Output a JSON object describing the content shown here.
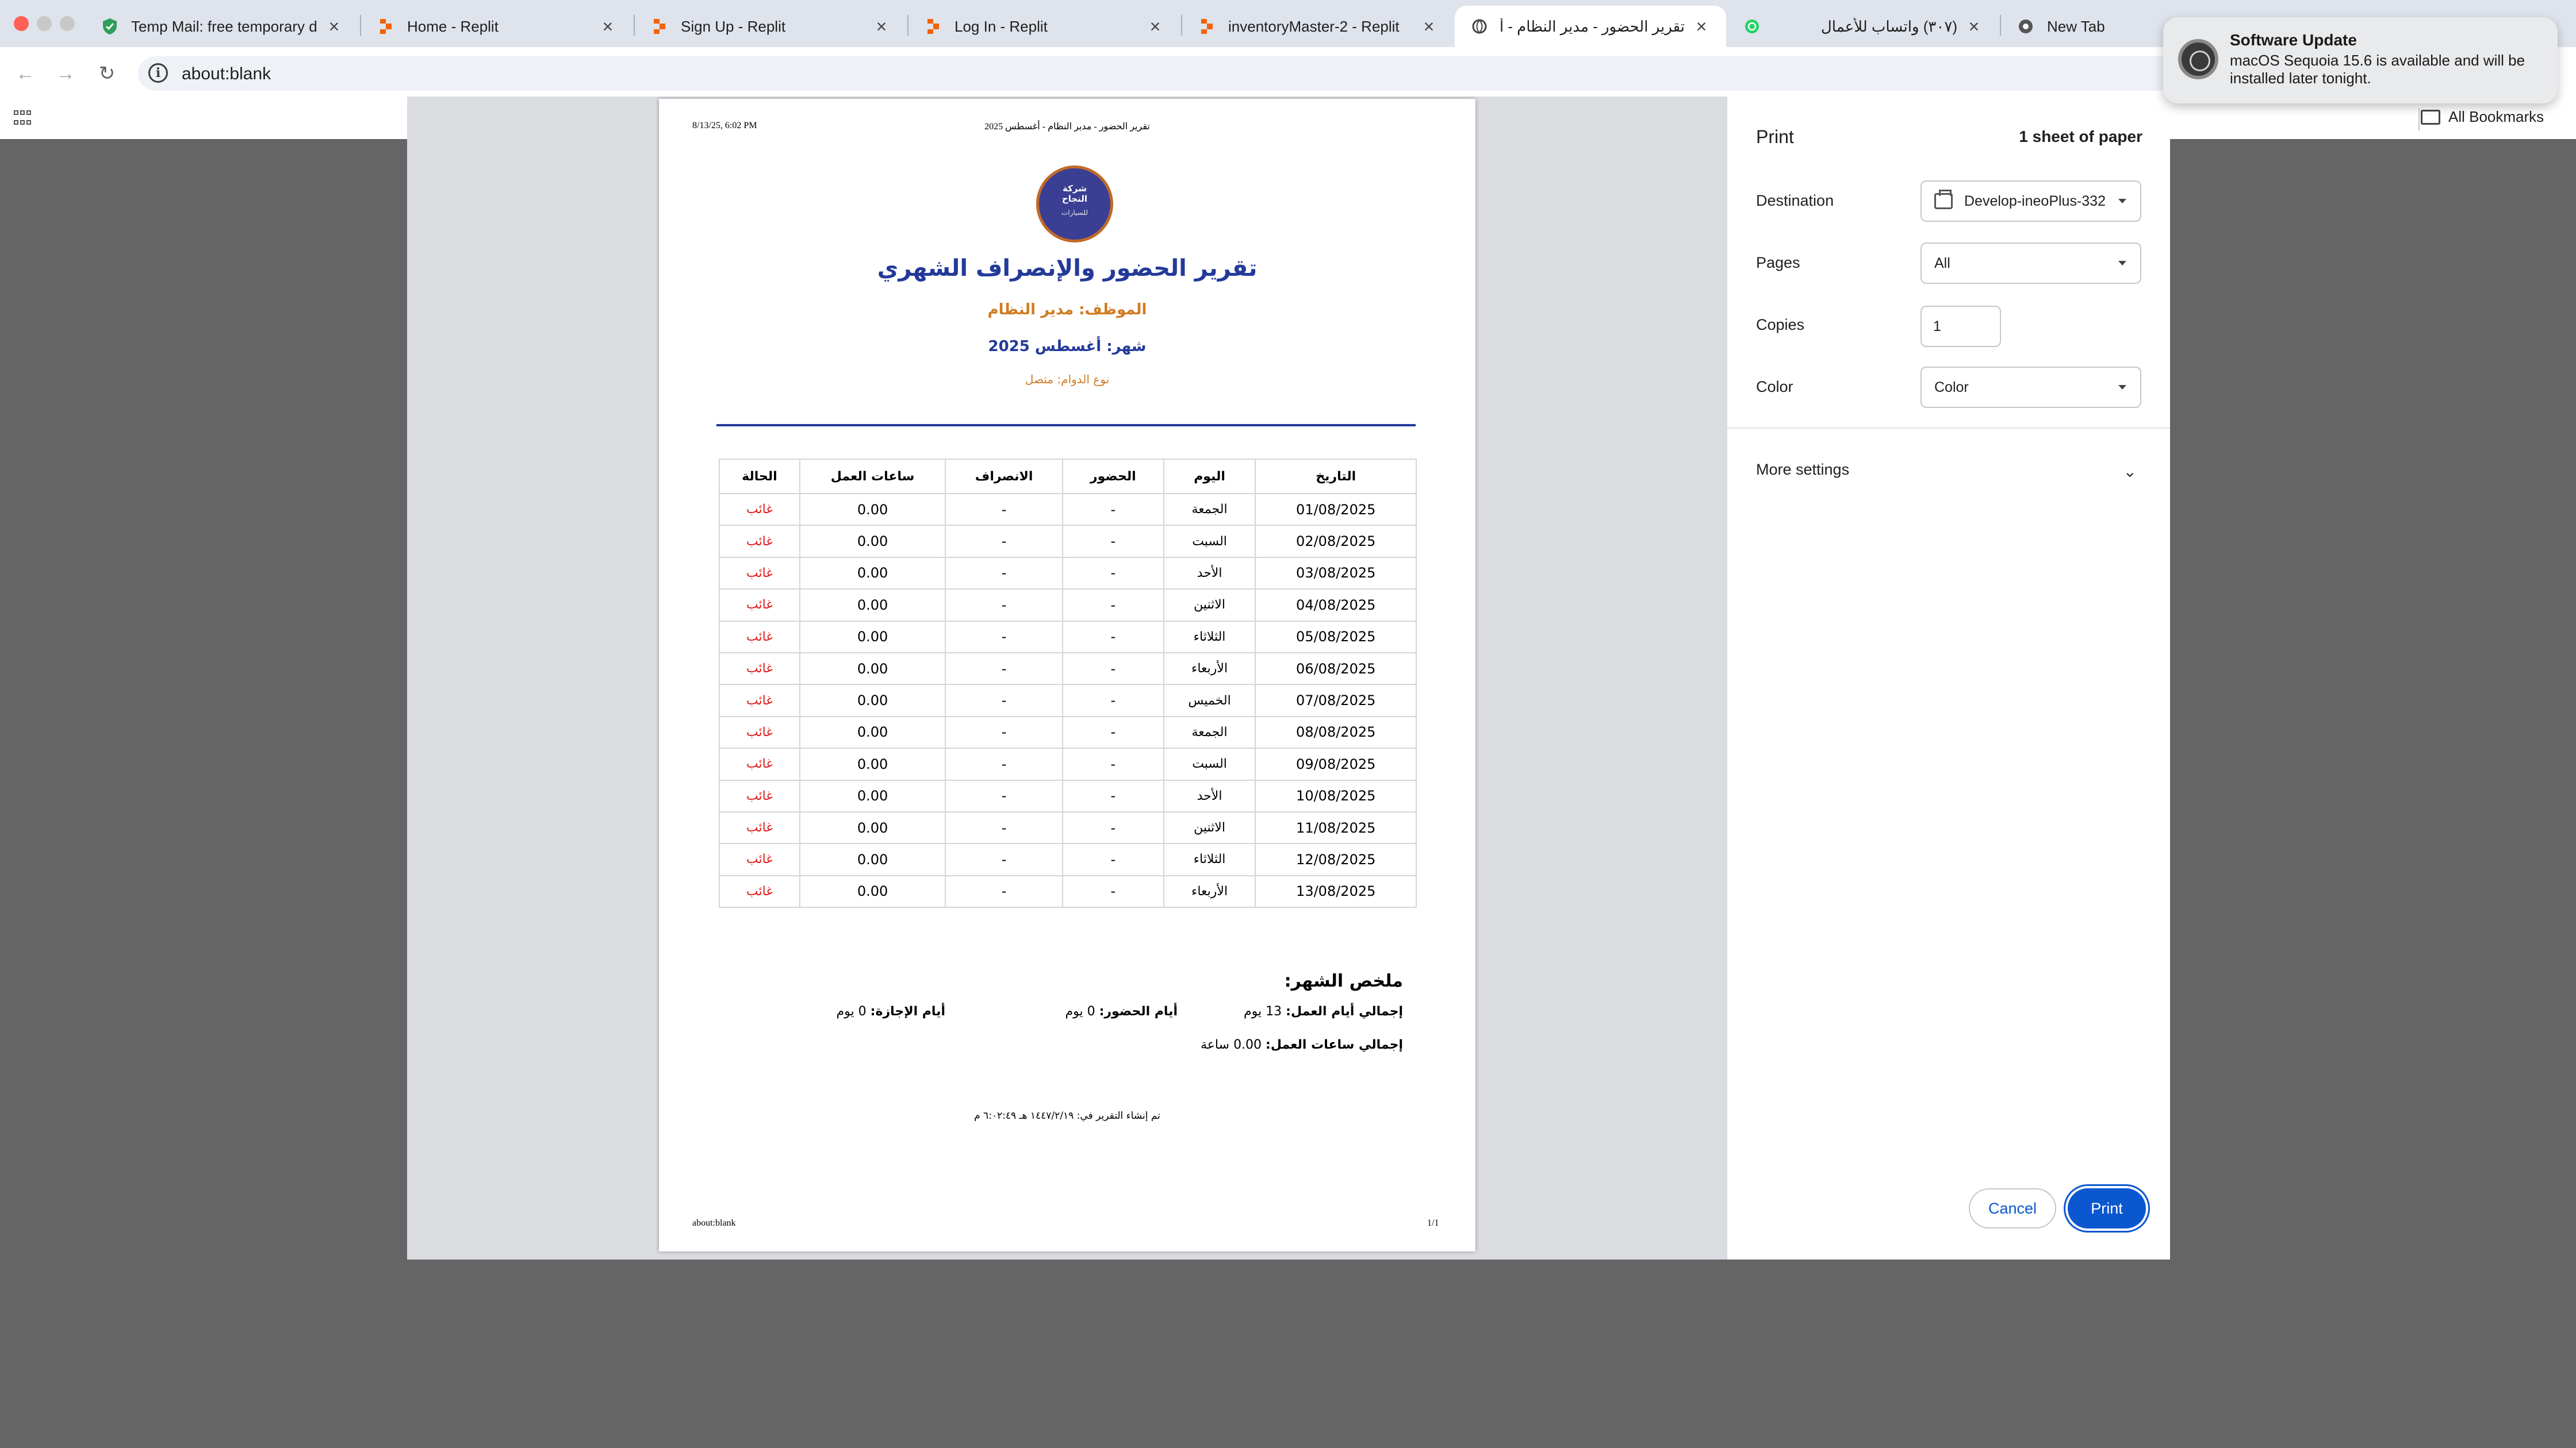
{
  "browser": {
    "tabs": [
      {
        "label": "Temp Mail: free temporary dis",
        "icon": "shield-check-icon",
        "color": "#2e9e5b"
      },
      {
        "label": "Home - Replit",
        "icon": "replit-icon",
        "color": "#f26207"
      },
      {
        "label": "Sign Up - Replit",
        "icon": "replit-icon",
        "color": "#f26207"
      },
      {
        "label": "Log In - Replit",
        "icon": "replit-icon",
        "color": "#f26207"
      },
      {
        "label": "inventoryMaster-2 - Replit",
        "icon": "replit-icon",
        "color": "#f26207"
      },
      {
        "label": "تقرير الحضور - مدير النظام - أغسطس",
        "icon": "globe-icon",
        "color": "#444444",
        "active": true
      },
      {
        "label": "(٣٠٧) واتساب للأعمال",
        "icon": "whatsapp-icon",
        "color": "#25d366"
      },
      {
        "label": "New Tab",
        "icon": "chrome-icon",
        "color": "#444444"
      }
    ],
    "url": "about:blank",
    "bookmarks_label": "All Bookmarks"
  },
  "report": {
    "header_left": "8/13/25, 6:02 PM",
    "header_center": "تقرير الحضور - مدير النظام - أغسطس 2025",
    "logo_line1": "شركة",
    "logo_line2": "النجاح",
    "logo_line3": "للسيارات",
    "title": "تقرير الحضور والإنصراف الشهري",
    "employee": "الموظف: مدير النظام",
    "month": "شهر: أغسطس 2025",
    "shift": "نوع الدوام: متصل",
    "columns": [
      "التاريخ",
      "اليوم",
      "الحضور",
      "الانصراف",
      "ساعات العمل",
      "الحالة"
    ],
    "rows": [
      {
        "date": "01/08/2025",
        "day": "الجمعة",
        "in": "-",
        "out": "-",
        "hours": "0.00",
        "status": "غائب"
      },
      {
        "date": "02/08/2025",
        "day": "السبت",
        "in": "-",
        "out": "-",
        "hours": "0.00",
        "status": "غائب"
      },
      {
        "date": "03/08/2025",
        "day": "الأحد",
        "in": "-",
        "out": "-",
        "hours": "0.00",
        "status": "غائب"
      },
      {
        "date": "04/08/2025",
        "day": "الاثنين",
        "in": "-",
        "out": "-",
        "hours": "0.00",
        "status": "غائب"
      },
      {
        "date": "05/08/2025",
        "day": "الثلاثاء",
        "in": "-",
        "out": "-",
        "hours": "0.00",
        "status": "غائب"
      },
      {
        "date": "06/08/2025",
        "day": "الأربعاء",
        "in": "-",
        "out": "-",
        "hours": "0.00",
        "status": "غائب"
      },
      {
        "date": "07/08/2025",
        "day": "الخميس",
        "in": "-",
        "out": "-",
        "hours": "0.00",
        "status": "غائب"
      },
      {
        "date": "08/08/2025",
        "day": "الجمعة",
        "in": "-",
        "out": "-",
        "hours": "0.00",
        "status": "غائب"
      },
      {
        "date": "09/08/2025",
        "day": "السبت",
        "in": "-",
        "out": "-",
        "hours": "0.00",
        "status": "غائب"
      },
      {
        "date": "10/08/2025",
        "day": "الأحد",
        "in": "-",
        "out": "-",
        "hours": "0.00",
        "status": "غائب"
      },
      {
        "date": "11/08/2025",
        "day": "الاثنين",
        "in": "-",
        "out": "-",
        "hours": "0.00",
        "status": "غائب"
      },
      {
        "date": "12/08/2025",
        "day": "الثلاثاء",
        "in": "-",
        "out": "-",
        "hours": "0.00",
        "status": "غائب"
      },
      {
        "date": "13/08/2025",
        "day": "الأربعاء",
        "in": "-",
        "out": "-",
        "hours": "0.00",
        "status": "غائب"
      }
    ],
    "summary_title": "ملخص الشهر:",
    "total_days_label": "إجمالي أيام العمل:",
    "total_days_value": "13 يوم",
    "present_days_label": "أيام الحضور:",
    "present_days_value": "0 يوم",
    "leave_days_label": "أيام الإجازة:",
    "leave_days_value": "0 يوم",
    "total_hours_label": "إجمالي ساعات العمل:",
    "total_hours_value": "0.00 ساعة",
    "generated_note": "تم إنشاء التقرير في: ١٤٤٧/٢/١٩ هـ ٦:٠٢:٤٩ م",
    "footer_left": "about:blank",
    "footer_right": "1/1"
  },
  "print_panel": {
    "title": "Print",
    "sheets": "1 sheet of paper",
    "destination_label": "Destination",
    "destination_value": "Develop-ineoPlus-332",
    "pages_label": "Pages",
    "pages_value": "All",
    "copies_label": "Copies",
    "copies_value": "1",
    "color_label": "Color",
    "color_value": "Color",
    "more_settings": "More settings",
    "cancel": "Cancel",
    "print": "Print"
  },
  "notification": {
    "title": "Software Update",
    "body": "macOS Sequoia 15.6 is available and will be installed later tonight."
  }
}
